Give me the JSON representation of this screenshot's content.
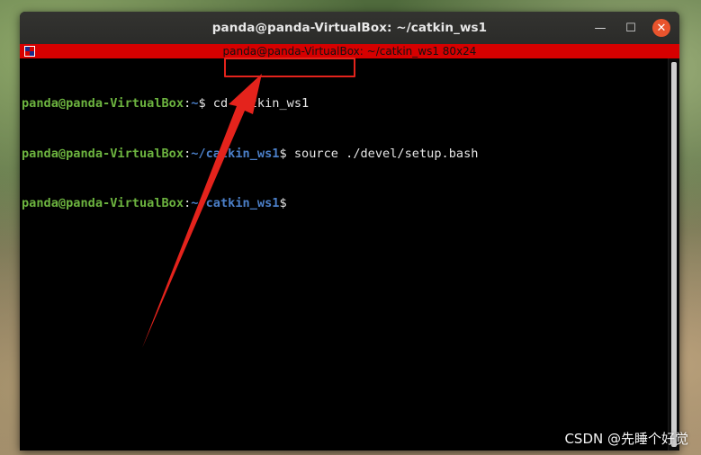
{
  "window": {
    "title": "panda@panda-VirtualBox: ~/catkin_ws1",
    "minimize_symbol": "—",
    "maximize_symbol": "☐",
    "close_symbol": "✕"
  },
  "xterm": {
    "title": "panda@panda-VirtualBox: ~/catkin_ws1 80x24"
  },
  "terminal": {
    "lines": [
      {
        "user": "panda@panda-VirtualBox",
        "sep": ":",
        "path": "~",
        "prompt": "$",
        "command": " cd catkin_ws1"
      },
      {
        "user": "panda@panda-VirtualBox",
        "sep": ":",
        "path": "~/catkin_ws1",
        "prompt": "$",
        "command": " source ./devel/setup.bash"
      },
      {
        "user": "panda@panda-VirtualBox",
        "sep": ":",
        "path": "~/catkin_ws1",
        "prompt": "$",
        "command": ""
      }
    ]
  },
  "annotation": {
    "highlight_color": "#e4231c"
  },
  "watermark": "CSDN @先睡个好觉",
  "colors": {
    "prompt_user": "#6cb33f",
    "prompt_path": "#4b7fc8",
    "xterm_bar": "#d60000",
    "close_button": "#e9542d"
  }
}
